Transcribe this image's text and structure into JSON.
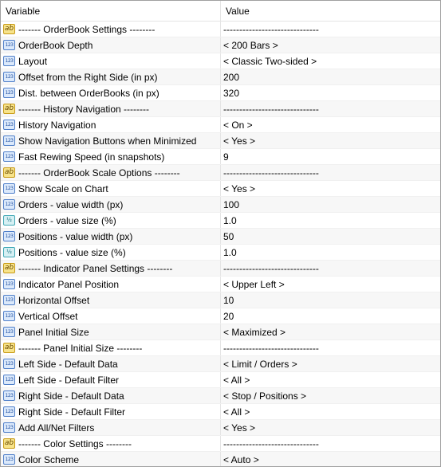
{
  "header": {
    "variable": "Variable",
    "value": "Value"
  },
  "icons": {
    "int": "123",
    "str": "ab",
    "dbl": "½"
  },
  "rows": [
    {
      "type": "str",
      "icon": "string-icon",
      "name": "------- OrderBook Settings --------",
      "value": "------------------------------"
    },
    {
      "type": "int",
      "icon": "integer-icon",
      "name": "OrderBook Depth",
      "value": "< 200 Bars >"
    },
    {
      "type": "int",
      "icon": "integer-icon",
      "name": "Layout",
      "value": "< Classic Two-sided >"
    },
    {
      "type": "int",
      "icon": "integer-icon",
      "name": "Offset from the Right Side (in px)",
      "value": "200"
    },
    {
      "type": "int",
      "icon": "integer-icon",
      "name": "Dist. between OrderBooks (in px)",
      "value": "320"
    },
    {
      "type": "str",
      "icon": "string-icon",
      "name": "------- History Navigation --------",
      "value": "------------------------------"
    },
    {
      "type": "int",
      "icon": "integer-icon",
      "name": "History Navigation",
      "value": "< On >"
    },
    {
      "type": "int",
      "icon": "integer-icon",
      "name": "Show Navigation Buttons when Minimized",
      "value": "< Yes >"
    },
    {
      "type": "int",
      "icon": "integer-icon",
      "name": "Fast Rewing Speed (in snapshots)",
      "value": "9"
    },
    {
      "type": "str",
      "icon": "string-icon",
      "name": "------- OrderBook Scale Options --------",
      "value": "------------------------------"
    },
    {
      "type": "int",
      "icon": "integer-icon",
      "name": "Show Scale on Chart",
      "value": "< Yes >"
    },
    {
      "type": "int",
      "icon": "integer-icon",
      "name": "Orders - value width (px)",
      "value": "100"
    },
    {
      "type": "dbl",
      "icon": "double-icon",
      "name": "Orders - value size (%)",
      "value": "1.0"
    },
    {
      "type": "int",
      "icon": "integer-icon",
      "name": "Positions - value width (px)",
      "value": "50"
    },
    {
      "type": "dbl",
      "icon": "double-icon",
      "name": "Positions - value size (%)",
      "value": "1.0"
    },
    {
      "type": "str",
      "icon": "string-icon",
      "name": "------- Indicator Panel Settings --------",
      "value": "------------------------------"
    },
    {
      "type": "int",
      "icon": "integer-icon",
      "name": "Indicator Panel Position",
      "value": "< Upper Left >"
    },
    {
      "type": "int",
      "icon": "integer-icon",
      "name": "Horizontal Offset",
      "value": "10"
    },
    {
      "type": "int",
      "icon": "integer-icon",
      "name": "Vertical Offset",
      "value": "20"
    },
    {
      "type": "int",
      "icon": "integer-icon",
      "name": "Panel Initial Size",
      "value": "< Maximized >"
    },
    {
      "type": "str",
      "icon": "string-icon",
      "name": "------- Panel Initial Size --------",
      "value": "------------------------------"
    },
    {
      "type": "int",
      "icon": "integer-icon",
      "name": "Left Side - Default Data",
      "value": "< Limit / Orders >"
    },
    {
      "type": "int",
      "icon": "integer-icon",
      "name": "Left Side - Default Filter",
      "value": "< All >"
    },
    {
      "type": "int",
      "icon": "integer-icon",
      "name": "Right Side - Default Data",
      "value": "< Stop / Positions >"
    },
    {
      "type": "int",
      "icon": "integer-icon",
      "name": "Right Side - Default Filter",
      "value": "< All >"
    },
    {
      "type": "int",
      "icon": "integer-icon",
      "name": "Add All/Net Filters",
      "value": "< Yes >"
    },
    {
      "type": "str",
      "icon": "string-icon",
      "name": "------- Color Settings --------",
      "value": "------------------------------"
    },
    {
      "type": "int",
      "icon": "integer-icon",
      "name": "Color Scheme",
      "value": "< Auto >"
    }
  ]
}
